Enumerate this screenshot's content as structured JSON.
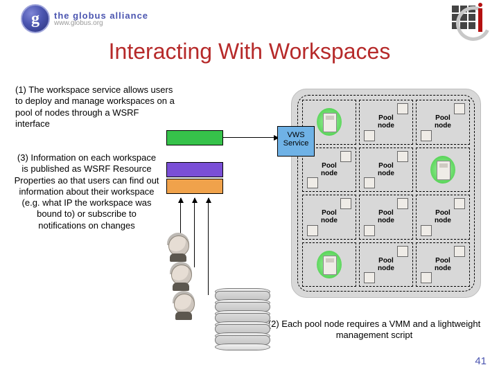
{
  "header": {
    "globus_logo_letter": "g",
    "globus_title": "the globus alliance",
    "globus_url": "www.globus.org"
  },
  "title": "Interacting With Workspaces",
  "text1": "(1) The workspace service allows users to deploy and manage workspaces on a pool of nodes through a WSRF interface",
  "text3": "(3) Information on each workspace is published as WSRF Resource Properties ao that users can find out information about their workspace (e.g. what IP the workspace was bound to) or subscribe to notifications on changes",
  "text2": "(2) Each pool node requires a VMM and a lightweight management script",
  "vws": {
    "l1": "VWS",
    "l2": "Service"
  },
  "pool_label": "Pool node",
  "grid": [
    {
      "vm": true,
      "label": false
    },
    {
      "vm": false,
      "label": true
    },
    {
      "vm": false,
      "label": true
    },
    {
      "vm": false,
      "label": true
    },
    {
      "vm": false,
      "label": true
    },
    {
      "vm": true,
      "label": false
    },
    {
      "vm": false,
      "label": true
    },
    {
      "vm": false,
      "label": true
    },
    {
      "vm": false,
      "label": true
    },
    {
      "vm": true,
      "label": false
    },
    {
      "vm": false,
      "label": true
    },
    {
      "vm": false,
      "label": true
    }
  ],
  "pagenum": "41"
}
